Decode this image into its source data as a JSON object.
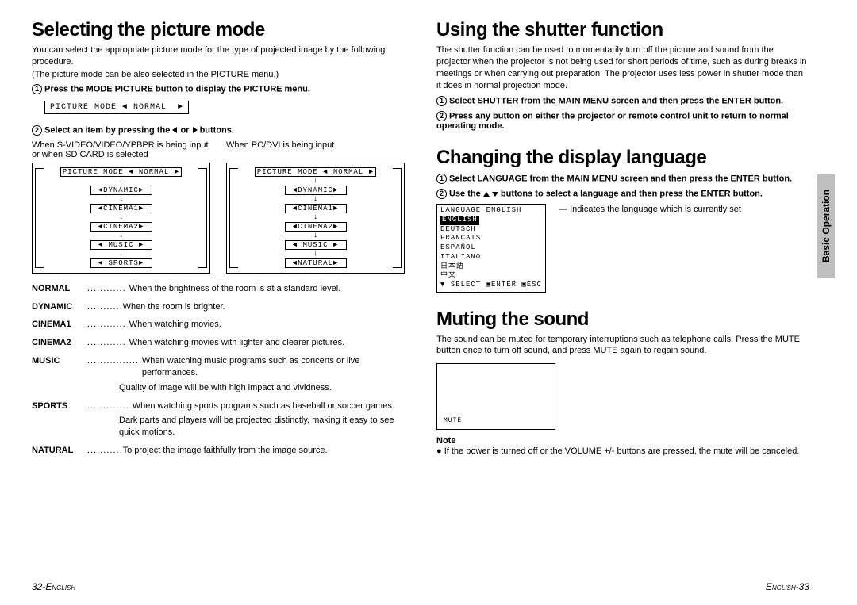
{
  "left": {
    "h1": "Selecting the picture mode",
    "intro1": "You can select the appropriate picture mode for the type of projected image by the following procedure.",
    "intro2": "(The picture mode can be also selected in the PICTURE menu.)",
    "step1": "Press the MODE PICTURE button to display the PICTURE menu.",
    "osd_top": "PICTURE MODE ◄ NORMAL  ►",
    "step2_prefix": "Select an item by pressing the ",
    "step2_suffix": " buttons.",
    "label_a": "When S-VIDEO/VIDEO/YPBPR is being input or when SD CARD is selected",
    "label_b": "When PC/DVI is being input",
    "flow_a": [
      "PICTURE MODE ◄ NORMAL  ►",
      "◄DYNAMIC►",
      "◄CINEMA1►",
      "◄CINEMA2►",
      "◄ MUSIC ►",
      "◄ SPORTS►"
    ],
    "flow_b": [
      "PICTURE MODE ◄ NORMAL  ►",
      "◄DYNAMIC►",
      "◄CINEMA1►",
      "◄CINEMA2►",
      "◄ MUSIC ►",
      "◄NATURAL►"
    ],
    "defs": [
      {
        "term": "NORMAL",
        "dots": "............",
        "desc": "When the brightness of the room is at a standard level."
      },
      {
        "term": "DYNAMIC",
        "dots": "..........",
        "desc": "When the room is brighter."
      },
      {
        "term": "CINEMA1",
        "dots": "............",
        "desc": "When watching movies."
      },
      {
        "term": "CINEMA2",
        "dots": "............",
        "desc": "When watching movies with lighter and clearer pictures."
      },
      {
        "term": "MUSIC",
        "dots": "................",
        "desc": "When watching music programs such as concerts or live performances."
      },
      {
        "term": "SPORTS",
        "dots": ".............",
        "desc": "When watching sports programs such as baseball or soccer games."
      },
      {
        "term": "NATURAL",
        "dots": "..........",
        "desc": "To project the image faithfully from the image source."
      }
    ],
    "sub_music": "Quality of image will be with high impact and vividness.",
    "sub_sports": "Dark parts and players will be projected distinctly, making it easy to see quick motions."
  },
  "right": {
    "h1a": "Using the shutter function",
    "shutter_intro": "The shutter function can be used to momentarily turn off the picture and sound from the projector when the projector is not being used for short periods of time, such as during breaks in meetings or when carrying out preparation. The projector uses less power in shutter mode than it does in normal projection mode.",
    "shutter_s1": "Select SHUTTER from the MAIN MENU screen and then press the ENTER button.",
    "shutter_s2": "Press any button on either the projector or remote control unit to return to normal operating mode.",
    "h1b": "Changing the display language",
    "lang_s1": "Select LANGUAGE from the MAIN MENU screen and then press the ENTER button.",
    "lang_s2_a": "Use the ",
    "lang_s2_b": " buttons to select a language and then press the ENTER button.",
    "lang_menu_header": " LANGUAGE     ENGLISH",
    "lang_items": [
      "ENGLISH",
      "DEUTSCH",
      "FRANÇAIS",
      "ESPAÑOL",
      "ITALIANO",
      "日本語",
      "中文"
    ],
    "lang_footer": " ▼ SELECT ▣ENTER  ▣ESC",
    "lang_note": "Indicates the language which is currently set",
    "h1c": "Muting the sound",
    "mute_intro": "The sound can be muted for temporary interruptions such as telephone calls. Press the MUTE button once to turn off sound, and press MUTE again to regain sound.",
    "mute_label": "MUTE",
    "note_head": "Note",
    "note_body": "● If the power is turned off or the VOLUME +/- buttons are pressed, the mute will be canceled."
  },
  "sidetab": "Basic Operation",
  "footer_left": "32-English",
  "footer_right": "English-33",
  "or_word": " or "
}
